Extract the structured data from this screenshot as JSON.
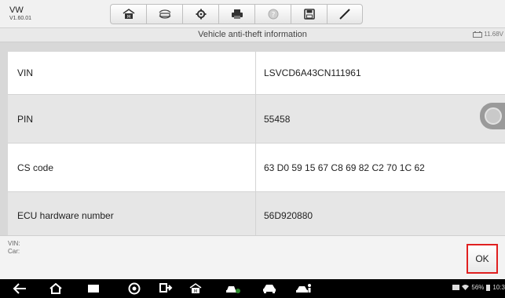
{
  "header": {
    "brand": "VW",
    "version": "V1.60.01",
    "toolbar": [
      {
        "icon": "home-icon"
      },
      {
        "icon": "vehicle-swap-icon"
      },
      {
        "icon": "settings-gear-icon"
      },
      {
        "icon": "printer-icon"
      },
      {
        "icon": "help-icon"
      },
      {
        "icon": "save-icon"
      },
      {
        "icon": "pen-icon"
      }
    ]
  },
  "subheader": {
    "title": "Vehicle anti-theft information",
    "battery": "11.68V"
  },
  "table": {
    "rows": [
      {
        "key": "VIN",
        "value": "LSVCD6A43CN111961"
      },
      {
        "key": "PIN",
        "value": "55458"
      },
      {
        "key": "CS code",
        "value": "63 D0 59 15 67 C8 69 82 C2 70 1C 62"
      },
      {
        "key": "ECU hardware number",
        "value": "56D920880"
      }
    ]
  },
  "footer": {
    "vin_label": "VIN:",
    "car_label": "Car:",
    "ok_label": "OK"
  },
  "navbar": {
    "status_text": "56%",
    "time": "10:3"
  },
  "colors": {
    "ok_highlight": "#e02020",
    "row_even": "#e6e6e6",
    "row_odd": "#ffffff"
  }
}
